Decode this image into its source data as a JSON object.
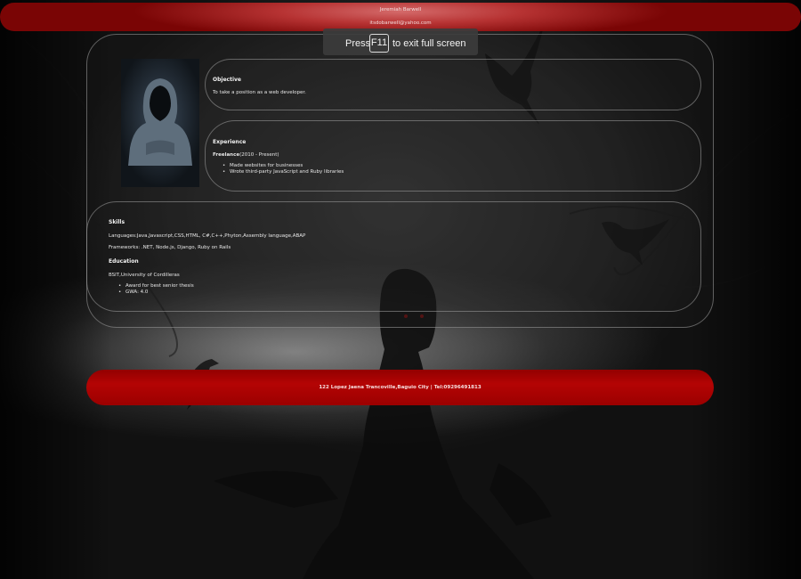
{
  "header": {
    "name": "Jeremiah Barwell",
    "email": "itsdobarwell@yahoo.com"
  },
  "fullscreen_notice": {
    "prefix": "Press",
    "key": "F11",
    "suffix": "to exit full screen"
  },
  "objective": {
    "heading": "Objective",
    "text": "To take a position as a web developer."
  },
  "experience": {
    "heading": "Experience",
    "role_label": "Freelance",
    "period": "(2010 - Present)",
    "items": [
      "Made websites for businesses",
      "Wrote third-party JavaScript and Ruby libraries"
    ]
  },
  "skills": {
    "heading": "Skills",
    "languages_label": "Languages:",
    "languages": "Java,Javascript,CSS,HTML, C#,C++,Phyton,Assembly language,ABAP",
    "frameworks_label": "Frameworks:",
    "frameworks": " .NET, Node.js, Django, Ruby on Rails"
  },
  "education": {
    "heading": "Education",
    "school": "BSIT,University of Cordilleras",
    "items": [
      "Award for best senior thesis",
      "GWA: 4.0"
    ]
  },
  "footer": {
    "address": "122 Lopez Jaena Trancoville,Baguio City | Tel:09296491813"
  },
  "colors": {
    "header_red": "#b73333",
    "footer_red": "#b40404",
    "background": "#1c1c1c"
  }
}
